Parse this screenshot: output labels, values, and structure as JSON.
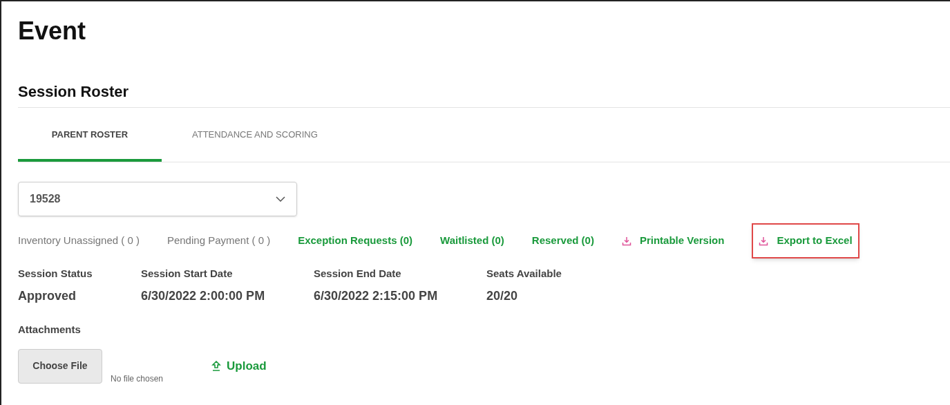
{
  "page_title": "Event",
  "section_title": "Session Roster",
  "tabs": [
    {
      "label": "PARENT ROSTER",
      "selected": true
    },
    {
      "label": "ATTENDANCE AND SCORING",
      "selected": false
    }
  ],
  "session_select": {
    "value": "19528"
  },
  "links": [
    {
      "kind": "count",
      "label": "Inventory Unassigned ( 0 )",
      "highlighted": false
    },
    {
      "kind": "count",
      "label": "Pending Payment ( 0 )",
      "highlighted": false
    },
    {
      "kind": "filter",
      "label": "Exception Requests (0)",
      "highlighted": false
    },
    {
      "kind": "filter",
      "label": "Waitlisted (0)",
      "highlighted": false
    },
    {
      "kind": "filter",
      "label": "Reserved (0)",
      "highlighted": false
    },
    {
      "kind": "download",
      "label": "Printable Version",
      "highlighted": false
    },
    {
      "kind": "download",
      "label": "Export to Excel",
      "highlighted": true
    }
  ],
  "details": [
    {
      "label": "Session Status",
      "value": "Approved"
    },
    {
      "label": "Session Start Date",
      "value": "6/30/2022 2:00:00 PM"
    },
    {
      "label": "Session End Date",
      "value": "6/30/2022 2:15:00 PM"
    },
    {
      "label": "Seats Available",
      "value": "20/20"
    }
  ],
  "attachments": {
    "label": "Attachments",
    "choose_button": "Choose File",
    "file_status": "No file chosen",
    "upload_link": "Upload"
  }
}
